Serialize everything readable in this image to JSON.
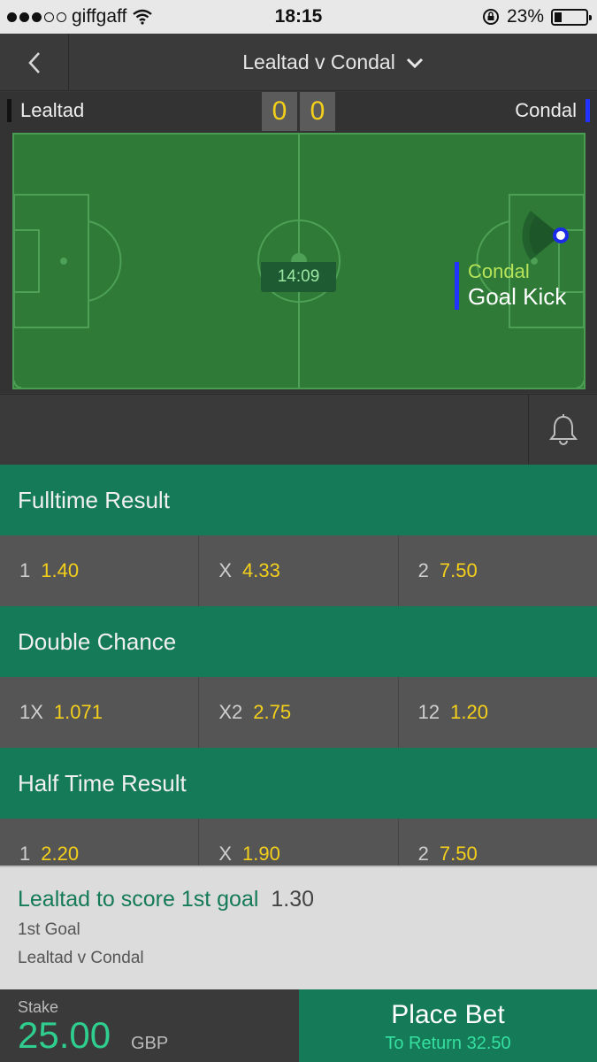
{
  "status_bar": {
    "carrier": "giffgaff",
    "time": "18:15",
    "battery": "23%",
    "battery_level": 0.23
  },
  "nav": {
    "title": "Lealtad v Condal"
  },
  "scoreboard": {
    "home_team": "Lealtad",
    "away_team": "Condal",
    "home_score": "0",
    "away_score": "0",
    "clock": "14:09",
    "home_color": "#111111",
    "away_color": "#2233ff"
  },
  "pitch_event": {
    "team": "Condal",
    "event": "Goal Kick"
  },
  "markets": [
    {
      "title": "Fulltime Result",
      "odds": [
        {
          "selection": "1",
          "price": "1.40"
        },
        {
          "selection": "X",
          "price": "4.33"
        },
        {
          "selection": "2",
          "price": "7.50"
        }
      ]
    },
    {
      "title": "Double Chance",
      "odds": [
        {
          "selection": "1X",
          "price": "1.071"
        },
        {
          "selection": "X2",
          "price": "2.75"
        },
        {
          "selection": "12",
          "price": "1.20"
        }
      ]
    },
    {
      "title": "Half Time Result",
      "odds": [
        {
          "selection": "1",
          "price": "2.20"
        },
        {
          "selection": "X",
          "price": "1.90"
        },
        {
          "selection": "2",
          "price": "7.50"
        }
      ]
    }
  ],
  "bet_slip": {
    "selection": "Lealtad to score 1st goal",
    "price": "1.30",
    "market": "1st Goal",
    "event": "Lealtad v Condal",
    "stake_label": "Stake",
    "stake": "25.00",
    "currency": "GBP",
    "place_label": "Place Bet",
    "return_text": "To Return 32.50"
  },
  "colors": {
    "accent_green": "#147a58",
    "price_yellow": "#f5d01b",
    "pitch_green": "#2e7a36"
  },
  "icons": {
    "back": "chevron-left-icon",
    "dropdown": "chevron-down-icon",
    "bell": "bell-icon",
    "wifi": "wifi-icon",
    "lock": "rotation-lock-icon"
  }
}
